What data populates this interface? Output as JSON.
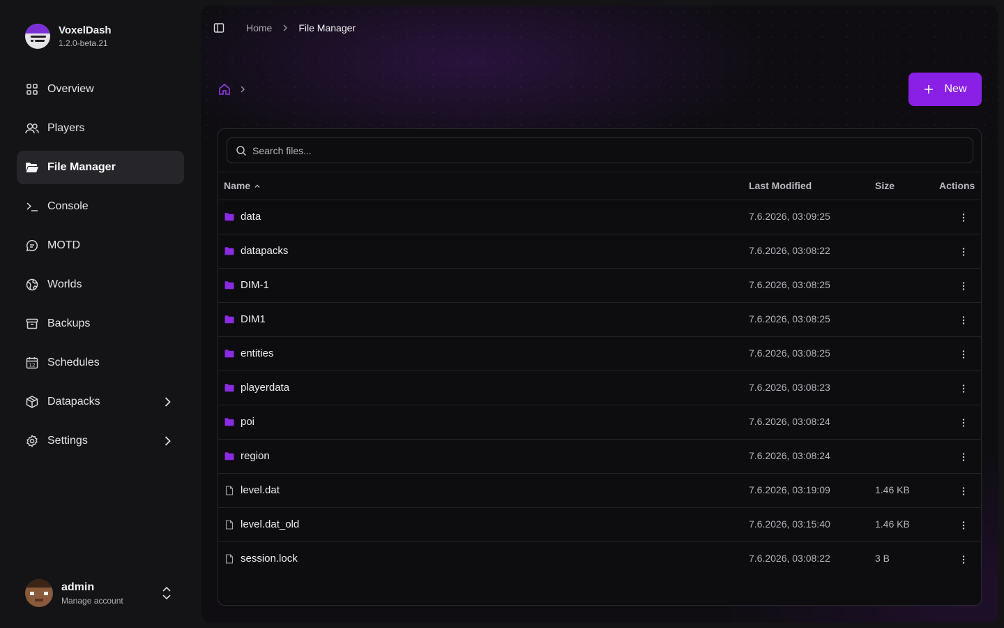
{
  "brand": {
    "name": "VoxelDash",
    "version": "1.2.0-beta.21"
  },
  "nav": {
    "items": [
      {
        "label": "Overview",
        "icon": "grid-icon"
      },
      {
        "label": "Players",
        "icon": "users-icon"
      },
      {
        "label": "File Manager",
        "icon": "folder-open-icon",
        "active": true
      },
      {
        "label": "Console",
        "icon": "terminal-icon"
      },
      {
        "label": "MOTD",
        "icon": "message-icon"
      },
      {
        "label": "Worlds",
        "icon": "globe-icon"
      },
      {
        "label": "Backups",
        "icon": "archive-icon"
      },
      {
        "label": "Schedules",
        "icon": "calendar-icon"
      },
      {
        "label": "Datapacks",
        "icon": "package-icon",
        "expandable": true
      },
      {
        "label": "Settings",
        "icon": "settings-icon",
        "expandable": true
      }
    ]
  },
  "account": {
    "name": "admin",
    "subtitle": "Manage account"
  },
  "breadcrumb": {
    "home": "Home",
    "current": "File Manager"
  },
  "toolbar": {
    "new_label": "New"
  },
  "search": {
    "placeholder": "Search files..."
  },
  "table": {
    "headers": {
      "name": "Name",
      "modified": "Last Modified",
      "size": "Size",
      "actions": "Actions"
    },
    "rows": [
      {
        "type": "folder",
        "name": "data",
        "modified": "7.6.2026, 03:09:25",
        "size": ""
      },
      {
        "type": "folder",
        "name": "datapacks",
        "modified": "7.6.2026, 03:08:22",
        "size": ""
      },
      {
        "type": "folder",
        "name": "DIM-1",
        "modified": "7.6.2026, 03:08:25",
        "size": ""
      },
      {
        "type": "folder",
        "name": "DIM1",
        "modified": "7.6.2026, 03:08:25",
        "size": ""
      },
      {
        "type": "folder",
        "name": "entities",
        "modified": "7.6.2026, 03:08:25",
        "size": ""
      },
      {
        "type": "folder",
        "name": "playerdata",
        "modified": "7.6.2026, 03:08:23",
        "size": ""
      },
      {
        "type": "folder",
        "name": "poi",
        "modified": "7.6.2026, 03:08:24",
        "size": ""
      },
      {
        "type": "folder",
        "name": "region",
        "modified": "7.6.2026, 03:08:24",
        "size": ""
      },
      {
        "type": "file",
        "name": "level.dat",
        "modified": "7.6.2026, 03:19:09",
        "size": "1.46 KB"
      },
      {
        "type": "file",
        "name": "level.dat_old",
        "modified": "7.6.2026, 03:15:40",
        "size": "1.46 KB"
      },
      {
        "type": "file",
        "name": "session.lock",
        "modified": "7.6.2026, 03:08:22",
        "size": "3 B"
      }
    ]
  },
  "colors": {
    "accent": "#8a1fe6",
    "folder": "#8b2be2",
    "background": "#141416",
    "panel": "#0f0d12"
  }
}
